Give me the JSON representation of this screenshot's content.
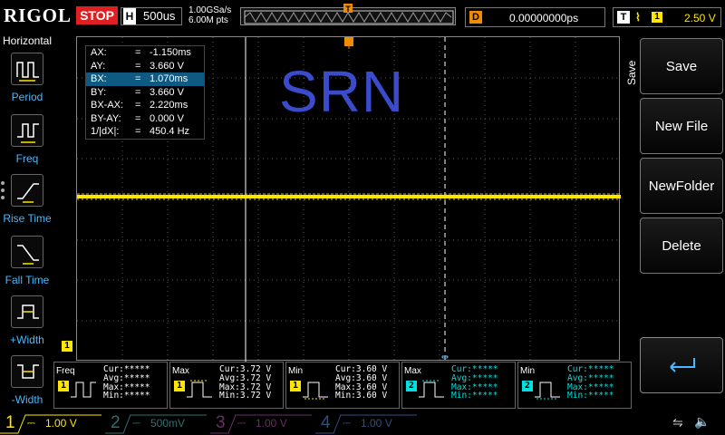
{
  "top": {
    "brand": "RIGOL",
    "run_state": "STOP",
    "horizontal_label": "H",
    "timebase": "500us",
    "sample_rate": "1.00GSa/s",
    "memory_depth": "6.00M pts",
    "delay_label": "D",
    "delay_value": "0.00000000ps",
    "trigger_label": "T",
    "trigger_source": "1",
    "trigger_level": "2.50 V",
    "trigger_marker": "T"
  },
  "left_menu": {
    "title": "Horizontal",
    "items": [
      {
        "label": "Period",
        "icon": "period-measure-icon"
      },
      {
        "label": "Freq",
        "icon": "freq-measure-icon"
      },
      {
        "label": "Rise Time",
        "icon": "rise-time-icon"
      },
      {
        "label": "Fall Time",
        "icon": "fall-time-icon"
      },
      {
        "label": "+Width",
        "icon": "positive-width-icon"
      },
      {
        "label": "-Width",
        "icon": "negative-width-icon"
      }
    ]
  },
  "cursor_panel": {
    "rows": [
      {
        "key": "AX:",
        "eq": "=",
        "value": "-1.150ms",
        "selected": false
      },
      {
        "key": "AY:",
        "eq": "=",
        "value": "3.660 V",
        "selected": false
      },
      {
        "key": "BX:",
        "eq": "=",
        "value": "1.070ms",
        "selected": true
      },
      {
        "key": "BY:",
        "eq": "=",
        "value": "3.660 V",
        "selected": false
      },
      {
        "key": "BX-AX:",
        "eq": "=",
        "value": "2.220ms",
        "selected": false
      },
      {
        "key": "BY-AY:",
        "eq": "=",
        "value": "0.000 V",
        "selected": false
      },
      {
        "key": "1/|dX|:",
        "eq": "=",
        "value": "450.4 Hz",
        "selected": false
      }
    ]
  },
  "overlay_text": "SRN",
  "ch1_ground_marker": "1",
  "right_menu": {
    "title": "Save",
    "buttons": [
      "Save",
      "New File",
      "NewFolder",
      "Delete"
    ]
  },
  "measurements": [
    {
      "name": "Freq",
      "ch": "1",
      "color": "#ffe600",
      "cur": "Cur:*****",
      "avg": "Avg:*****",
      "max": "Max:*****",
      "min": "Min:*****"
    },
    {
      "name": "Max",
      "ch": "1",
      "color": "#ffe600",
      "cur": "Cur:3.72 V",
      "avg": "Avg:3.72 V",
      "max": "Max:3.72 V",
      "min": "Min:3.72 V"
    },
    {
      "name": "Min",
      "ch": "1",
      "color": "#ffe600",
      "cur": "Cur:3.60 V",
      "avg": "Avg:3.60 V",
      "max": "Max:3.60 V",
      "min": "Min:3.60 V"
    },
    {
      "name": "Max",
      "ch": "2",
      "color": "#00e0e0",
      "cur": "Cur:*****",
      "avg": "Avg:*****",
      "max": "Max:*****",
      "min": "Min:*****"
    },
    {
      "name": "Min",
      "ch": "2",
      "color": "#00e0e0",
      "cur": "Cur:*****",
      "avg": "Avg:*****",
      "max": "Max:*****",
      "min": "Min:*****"
    }
  ],
  "channels": [
    {
      "num": "1",
      "scale": "1.00 V",
      "color": "#ffe600",
      "active": true
    },
    {
      "num": "2",
      "scale": "500mV",
      "color": "#2f6f6f",
      "active": false
    },
    {
      "num": "3",
      "scale": "1.00 V",
      "color": "#6a2f6a",
      "active": false
    },
    {
      "num": "4",
      "scale": "1.00 V",
      "color": "#2f4f7f",
      "active": false
    }
  ]
}
